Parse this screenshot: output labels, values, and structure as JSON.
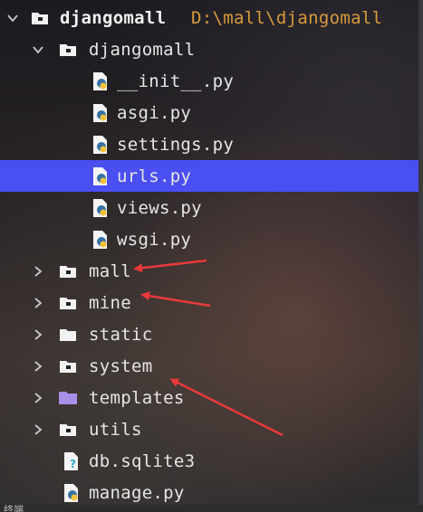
{
  "project": {
    "name": "djangomall",
    "path": "D:\\mall\\djangomall"
  },
  "tree": [
    {
      "label": "djangomall",
      "kind": "folder",
      "expanded": true
    },
    {
      "label": "__init__.py",
      "kind": "python-file"
    },
    {
      "label": "asgi.py",
      "kind": "python-file"
    },
    {
      "label": "settings.py",
      "kind": "python-file"
    },
    {
      "label": "urls.py",
      "kind": "python-file",
      "selected": true
    },
    {
      "label": "views.py",
      "kind": "python-file"
    },
    {
      "label": "wsgi.py",
      "kind": "python-file"
    },
    {
      "label": "mall",
      "kind": "folder"
    },
    {
      "label": "mine",
      "kind": "folder"
    },
    {
      "label": "static",
      "kind": "folder"
    },
    {
      "label": "system",
      "kind": "folder"
    },
    {
      "label": "templates",
      "kind": "template-folder"
    },
    {
      "label": "utils",
      "kind": "folder"
    },
    {
      "label": "db.sqlite3",
      "kind": "unknown-file"
    },
    {
      "label": "manage.py",
      "kind": "python-file"
    }
  ],
  "status_text": "终端",
  "colors": {
    "selection": "#4a4ff2",
    "path_text": "#d89a3c",
    "annotation_arrow": "#e83a3a",
    "template_folder": "#a98ee6"
  }
}
